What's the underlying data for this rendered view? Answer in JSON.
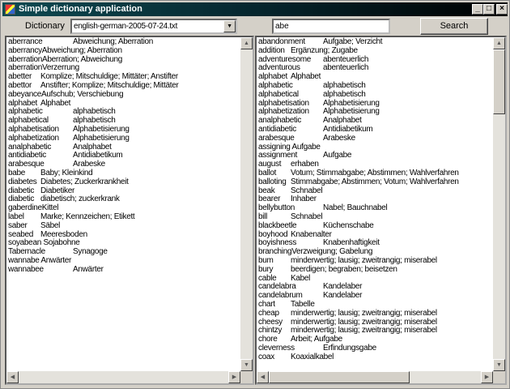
{
  "window": {
    "title": "Simple dictionary application"
  },
  "toolbar": {
    "dictionary_label": "Dictionary",
    "dictionary_value": "english-german-2005-07-24.txt",
    "search_value": "abe",
    "search_button": "Search"
  },
  "left_list": [
    "aberrance\tAbweichung; Aberration",
    "aberrancyAbweichung; Aberration",
    "aberrationAberration; Abweichung",
    "aberrationVerzerrung",
    "abetter\tKomplize; Mitschuldige; Mittäter; Anstifter",
    "abettor\tAnstifter; Komplize; Mitschuldige; Mittäter",
    "abeyanceAufschub; Verschiebung",
    "alphabet\tAlphabet",
    "alphabetic\talphabetisch",
    "alphabetical\talphabetisch",
    "alphabetisation\tAlphabetisierung",
    "alphabetization\tAlphabetisierung",
    "analphabetic\tAnalphabet",
    "antidiabetic\tAntidiabetikum",
    "arabesque\tArabeske",
    "babe\tBaby; Kleinkind",
    "diabetes\tDiabetes; Zuckerkrankheit",
    "diabetic\tDiabetiker",
    "diabetic\tdiabetisch; zuckerkrank",
    "gaberdineKittel",
    "label\tMarke; Kennzeichen; Etikett",
    "saber\tSäbel",
    "seabed\tMeeresboden",
    "soyabean Sojabohne",
    "Tabernacle\tSynagoge",
    "wannabe Anwärter",
    "wannabee\tAnwärter"
  ],
  "right_list": [
    "abandonment\tAufgabe; Verzicht",
    "addition\tErgänzung; Zugabe",
    "adventuresome\tabenteuerlich",
    "adventurous\tabenteuerlich",
    "alphabet\tAlphabet",
    "alphabetic\talphabetisch",
    "alphabetical\talphabetisch",
    "alphabetisation\tAlphabetisierung",
    "alphabetization\tAlphabetisierung",
    "analphabetic\tAnalphabet",
    "antidiabetic\tAntidiabetikum",
    "arabesque\tArabeske",
    "assigning Aufgabe",
    "assignment\tAufgabe",
    "august\terhaben",
    "ballot\tVotum; Stimmabgabe; Abstimmen; Wahlverfahren",
    "balloting\tStimmabgabe; Abstimmen; Votum; Wahlverfahren",
    "beak\tSchnabel",
    "bearer\tInhaber",
    "bellybutton\tNabel; Bauchnabel",
    "bill\tSchnabel",
    "blackbeetle\tKüchenschabe",
    "boyhood\tKnabenalter",
    "boyishness\tKnabenhaftigkeit",
    "branchingVerzweigung; Gabelung",
    "bum\tminderwertig; lausig; zweitrangig; miserabel",
    "bury\tbeerdigen; begraben; beisetzen",
    "cable\tKabel",
    "candelabra\tKandelaber",
    "candelabrum\tKandelaber",
    "chart\tTabelle",
    "cheap\tminderwertig; lausig; zweitrangig; miserabel",
    "cheesy\tminderwertig; lausig; zweitrangig; miserabel",
    "chintzy\tminderwertig; lausig; zweitrangig; miserabel",
    "chore\tArbeit; Aufgabe",
    "cleverness\tErfindungsgabe",
    "coax\tKoaxialkabel"
  ],
  "icons": {
    "minimize": "_",
    "maximize": "□",
    "close": "×",
    "up": "▲",
    "down": "▼",
    "left": "◀",
    "right": "▶"
  }
}
